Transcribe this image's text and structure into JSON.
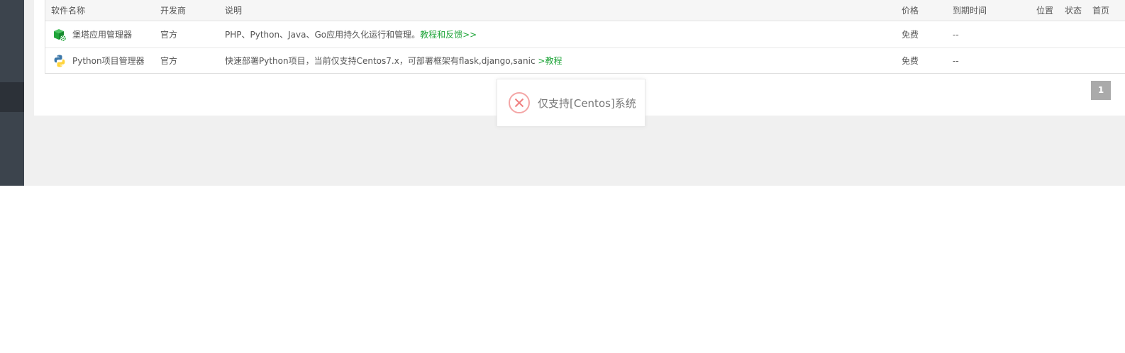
{
  "table": {
    "headers": {
      "name": "软件名称",
      "developer": "开发商",
      "description": "说明",
      "price": "价格",
      "expiry": "到期时间",
      "location": "位置",
      "status": "状态",
      "home": "首页"
    },
    "rows": [
      {
        "icon": "green-cube-gear-icon",
        "name": "堡塔应用管理器",
        "developer": "官方",
        "description": "PHP、Python、Java、Go应用持久化运行和管理。",
        "link": "教程和反馈>>",
        "price": "免费",
        "expiry": "--"
      },
      {
        "icon": "python-logo-icon",
        "name": "Python项目管理器",
        "developer": "官方",
        "description": "快速部署Python项目，当前仅支持Centos7.x，可部署框架有flask,django,sanic ",
        "link": ">教程",
        "price": "免费",
        "expiry": "--"
      }
    ]
  },
  "pagination": {
    "current": "1"
  },
  "toast": {
    "icon": "error-x-icon",
    "message": "仅支持[Centos]系统"
  },
  "colors": {
    "link": "#20a53a",
    "sidebar": "#3c444d",
    "error": "#f08080"
  }
}
